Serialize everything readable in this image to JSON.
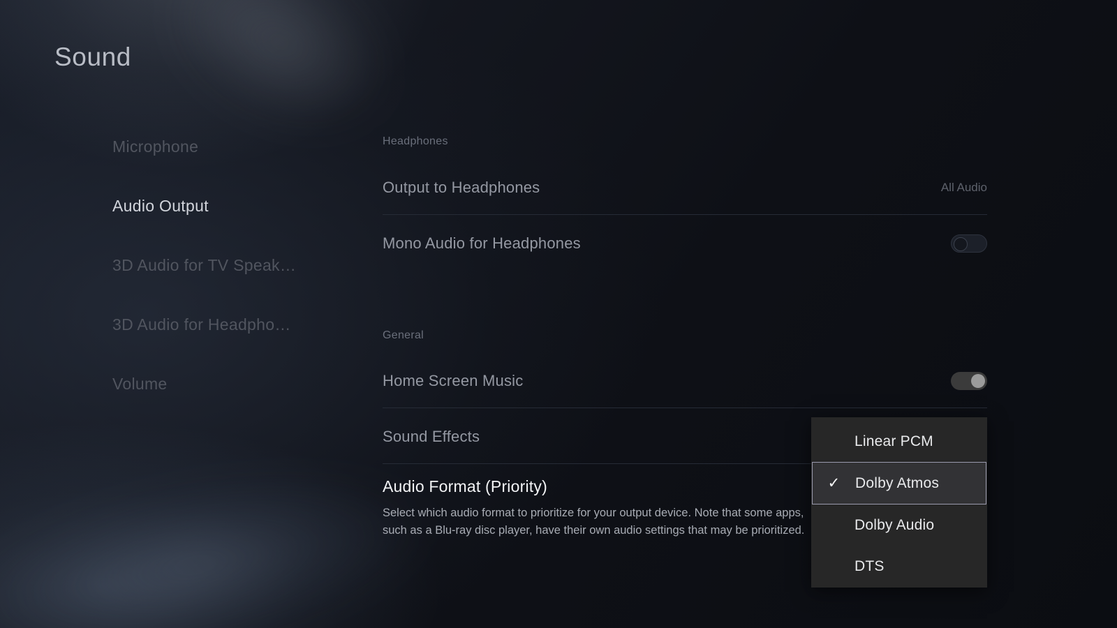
{
  "page": {
    "title": "Sound"
  },
  "sidebar": {
    "items": [
      {
        "label": "Microphone",
        "active": false
      },
      {
        "label": "Audio Output",
        "active": true
      },
      {
        "label": "3D Audio for TV Speak…",
        "active": false
      },
      {
        "label": "3D Audio for Headpho…",
        "active": false
      },
      {
        "label": "Volume",
        "active": false
      }
    ]
  },
  "sections": {
    "headphones": {
      "header": "Headphones",
      "rows": [
        {
          "label": "Output to Headphones",
          "value": "All Audio"
        },
        {
          "label": "Mono Audio for Headphones",
          "toggle": "off"
        }
      ]
    },
    "general": {
      "header": "General",
      "rows": [
        {
          "label": "Home Screen Music",
          "toggle": "on"
        },
        {
          "label": "Sound Effects"
        }
      ]
    }
  },
  "focused_setting": {
    "title": "Audio Format (Priority)",
    "description": "Select which audio format to prioritize for your output device. Note that some apps, such as a Blu-ray disc player, have their own audio settings that may be prioritized."
  },
  "dropdown": {
    "selected": "Dolby Atmos",
    "check_glyph": "✓",
    "options": [
      {
        "label": "Linear PCM",
        "selected": false
      },
      {
        "label": "Dolby Atmos",
        "selected": true
      },
      {
        "label": "Dolby Audio",
        "selected": false
      },
      {
        "label": "DTS",
        "selected": false
      }
    ]
  },
  "colors": {
    "background": "#0e1016",
    "title_text": "#b9bdc6",
    "active_text": "#d2d5dc",
    "dim_text": "#51555f",
    "focus_text": "#f2f3f5",
    "popup_bg": "#272727",
    "selection_border": "#9a9aad",
    "toggle_on_knob": "#9b9b9b"
  }
}
